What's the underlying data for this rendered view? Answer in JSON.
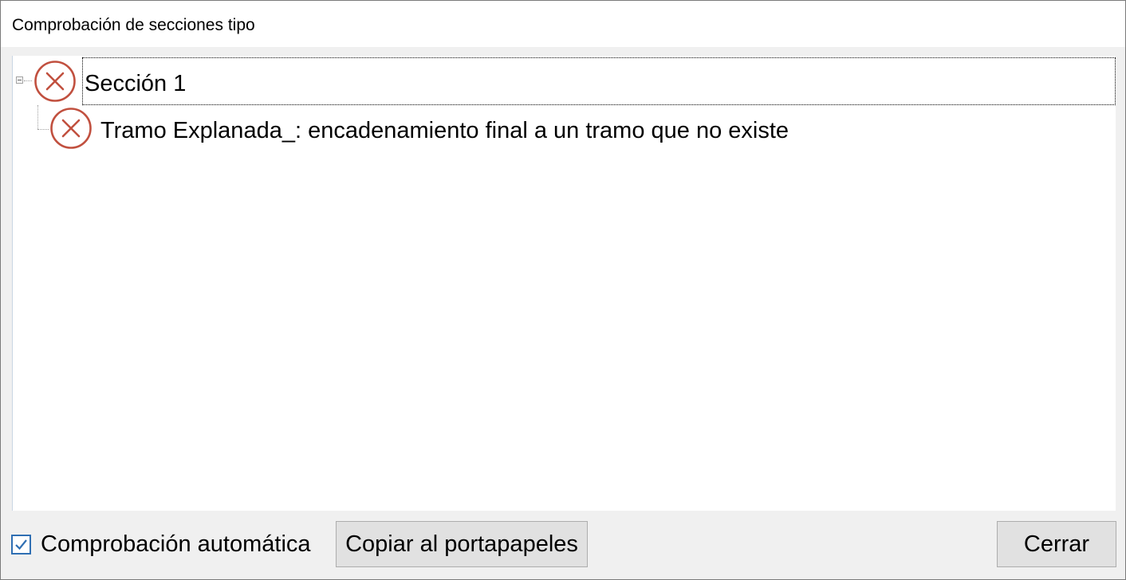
{
  "window": {
    "title": "Comprobación de secciones tipo"
  },
  "tree": {
    "root": {
      "label": "Sección 1",
      "icon": "error-circle-icon",
      "expanded": true,
      "selected": true
    },
    "children": [
      {
        "label": "Tramo Explanada_: encadenamiento final a un tramo que no existe",
        "icon": "error-circle-icon"
      }
    ]
  },
  "footer": {
    "auto_check_label": "Comprobación automática",
    "auto_check_checked": true,
    "copy_button_label": "Copiar al portapapeles",
    "close_button_label": "Cerrar"
  },
  "colors": {
    "error_icon": "#c1503f",
    "checkbox_accent": "#2f6fb3"
  }
}
